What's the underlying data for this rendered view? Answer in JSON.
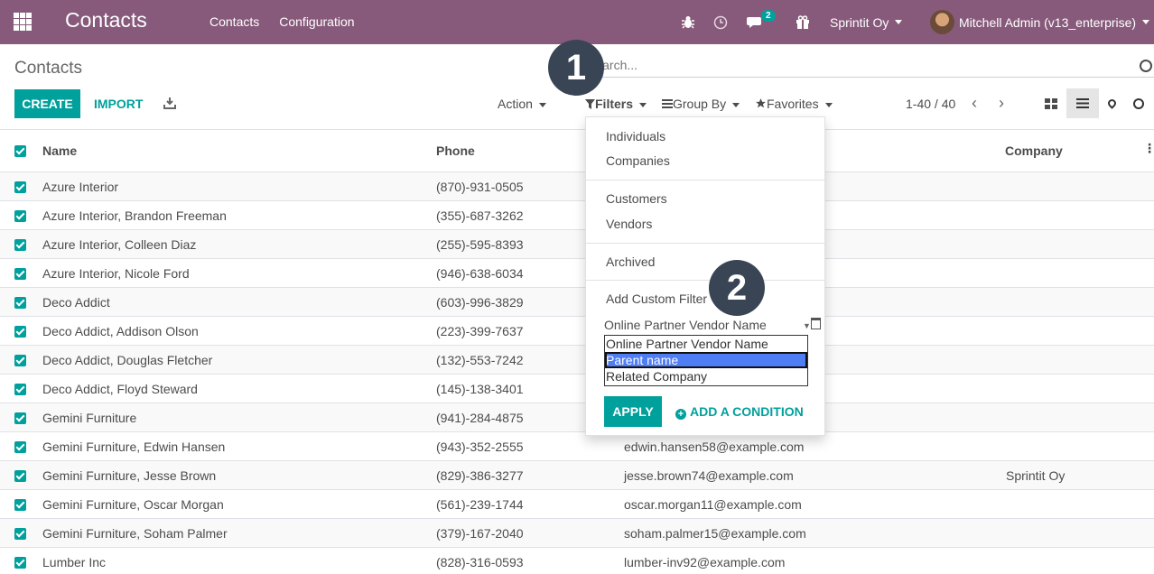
{
  "navbar": {
    "brand": "Contacts",
    "menu": [
      "Contacts",
      "Configuration"
    ],
    "chat_badge": "2",
    "company": "Sprintit Oy",
    "user": "Mitchell Admin (v13_enterprise)",
    "icons": [
      "apps-icon",
      "bug-icon",
      "clock-icon",
      "chat-icon",
      "gift-icon"
    ]
  },
  "control_panel": {
    "breadcrumb": "Contacts",
    "search_placeholder": "Search...",
    "create_label": "CREATE",
    "import_label": "IMPORT",
    "action_label": "Action",
    "filters_label": "Filters",
    "groupby_label": "Group By",
    "favorites_label": "Favorites",
    "pager": "1-40 / 40"
  },
  "table": {
    "columns": [
      "Name",
      "Phone",
      "Company"
    ],
    "rows": [
      {
        "name": "Azure Interior",
        "phone": "(870)-931-0505",
        "email": "",
        "company": ""
      },
      {
        "name": "Azure Interior, Brandon Freeman",
        "phone": "(355)-687-3262",
        "email": "",
        "company": ""
      },
      {
        "name": "Azure Interior, Colleen Diaz",
        "phone": "(255)-595-8393",
        "email": "",
        "company": ""
      },
      {
        "name": "Azure Interior, Nicole Ford",
        "phone": "(946)-638-6034",
        "email": "",
        "company": ""
      },
      {
        "name": "Deco Addict",
        "phone": "(603)-996-3829",
        "email": "",
        "company": ""
      },
      {
        "name": "Deco Addict, Addison Olson",
        "phone": "(223)-399-7637",
        "email": "",
        "company": ""
      },
      {
        "name": "Deco Addict, Douglas Fletcher",
        "phone": "(132)-553-7242",
        "email": "",
        "company": ""
      },
      {
        "name": "Deco Addict, Floyd Steward",
        "phone": "(145)-138-3401",
        "email": "",
        "company": ""
      },
      {
        "name": "Gemini Furniture",
        "phone": "(941)-284-4875",
        "email": "",
        "company": ""
      },
      {
        "name": "Gemini Furniture, Edwin Hansen",
        "phone": "(943)-352-2555",
        "email": "edwin.hansen58@example.com",
        "company": ""
      },
      {
        "name": "Gemini Furniture, Jesse Brown",
        "phone": "(829)-386-3277",
        "email": "jesse.brown74@example.com",
        "company": "Sprintit Oy"
      },
      {
        "name": "Gemini Furniture, Oscar Morgan",
        "phone": "(561)-239-1744",
        "email": "oscar.morgan11@example.com",
        "company": ""
      },
      {
        "name": "Gemini Furniture, Soham Palmer",
        "phone": "(379)-167-2040",
        "email": "soham.palmer15@example.com",
        "company": ""
      },
      {
        "name": "Lumber Inc",
        "phone": "(828)-316-0593",
        "email": "lumber-inv92@example.com",
        "company": ""
      }
    ]
  },
  "filters_dropdown": {
    "group1": [
      "Individuals",
      "Companies"
    ],
    "group2": [
      "Customers",
      "Vendors"
    ],
    "group3": [
      "Archived"
    ],
    "add_custom_filter": "Add Custom Filter",
    "field_select_value": "Online Partner Vendor Name",
    "field_options": [
      "Online Partner Vendor Name",
      "Parent name",
      "Related Company"
    ],
    "selected_option": "Parent name",
    "apply_label": "APPLY",
    "add_condition_label": "ADD A CONDITION"
  },
  "markers": [
    "1",
    "2"
  ],
  "colors": {
    "navbar": "#875a7b",
    "primary": "#00a09d",
    "marker": "#394555",
    "selected_option": "#4f7df4"
  }
}
